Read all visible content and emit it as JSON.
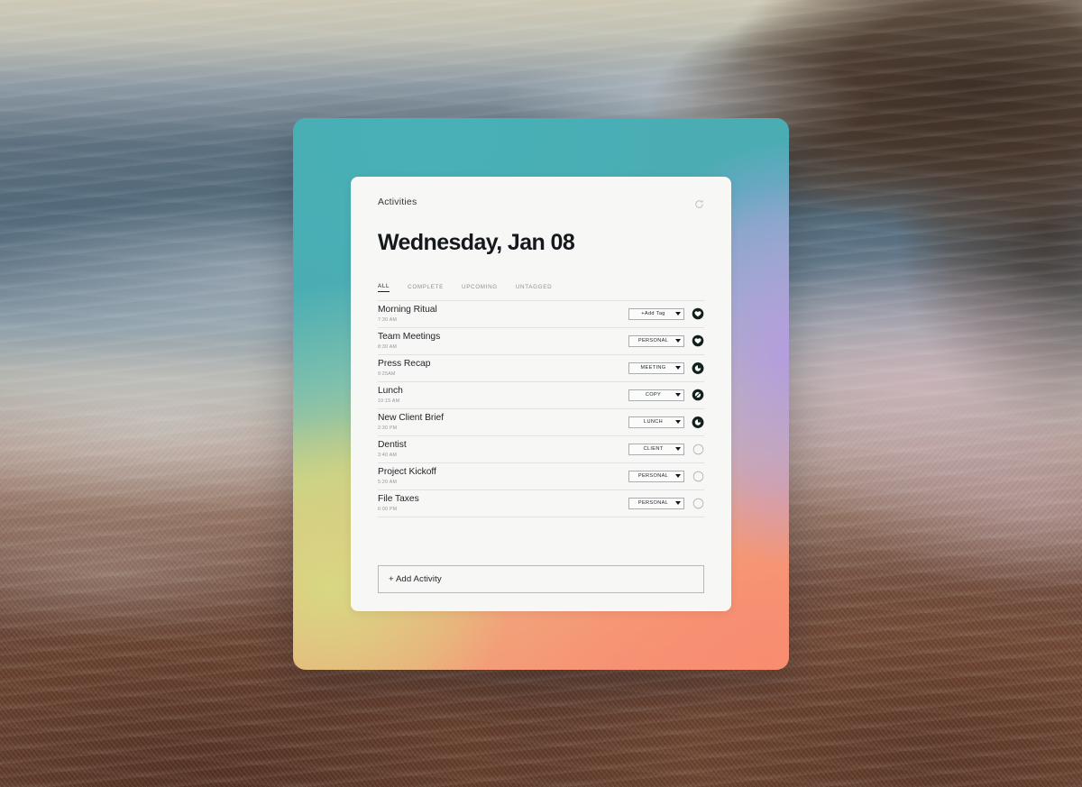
{
  "wallpaper": {
    "description": "ocean-wave-rocks-photo"
  },
  "window": {
    "gradient": {
      "teal": "#4aadb4",
      "purple": "#b49be2",
      "yellow_green": "#c8cc84",
      "coral": "#f79274"
    }
  },
  "card": {
    "app_label": "Activities",
    "sync_icon": "refresh-icon",
    "title": "Wednesday, Jan 08",
    "tabs": [
      {
        "label": "ALL",
        "active": true
      },
      {
        "label": "COMPLETE",
        "active": false
      },
      {
        "label": "UPCOMING",
        "active": false
      },
      {
        "label": "UNTAGGED",
        "active": false
      }
    ],
    "tasks": [
      {
        "name": "Morning Ritual",
        "time": "7:30 AM",
        "tag": "+Add Tag",
        "status": "heart-filled"
      },
      {
        "name": "Team Meetings",
        "time": "8:30 AM",
        "tag": "PERSONAL",
        "status": "heart-filled"
      },
      {
        "name": "Press Recap",
        "time": "9:25AM",
        "tag": "MEETING",
        "status": "ring-filled"
      },
      {
        "name": "Lunch",
        "time": "10:15 AM",
        "tag": "COPY",
        "status": "slash-filled"
      },
      {
        "name": "New Client Brief",
        "time": "2:30 PM",
        "tag": "LUNCH",
        "status": "ring-filled"
      },
      {
        "name": "Dentist",
        "time": "3:40 AM",
        "tag": "CLIENT",
        "status": "empty"
      },
      {
        "name": "Project Kickoff",
        "time": "5:20 AM",
        "tag": "PERSONAL",
        "status": "empty"
      },
      {
        "name": "File Taxes",
        "time": "6:00 PM",
        "tag": "PERSONAL",
        "status": "empty"
      }
    ],
    "add_activity_label": "+ Add Activity"
  }
}
